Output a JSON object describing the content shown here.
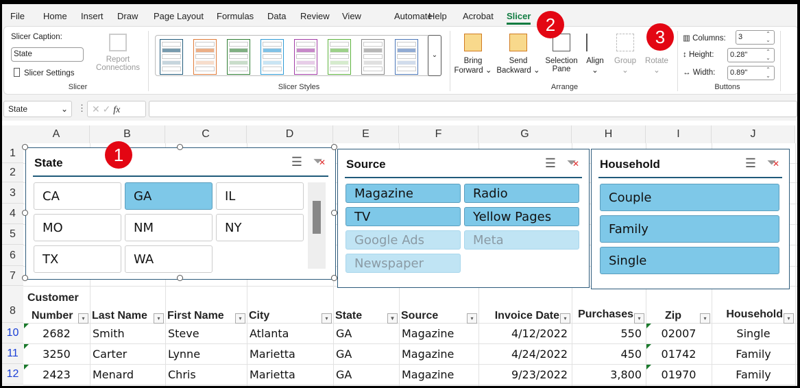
{
  "menu_tabs": [
    "File",
    "Home",
    "Insert",
    "Draw",
    "Page Layout",
    "Formulas",
    "Data",
    "Review",
    "View",
    "Automate",
    "Help",
    "Acrobat",
    "Slicer"
  ],
  "active_tab": "Slicer",
  "ribbon": {
    "slicer_group": {
      "caption_label": "Slicer Caption:",
      "caption_value": "State",
      "settings": "Slicer Settings",
      "report_connections": "Report Connections",
      "group_label": "Slicer"
    },
    "styles_group": {
      "group_label": "Slicer Styles",
      "colors": [
        "#1f5a7a",
        "#e07b39",
        "#2e7d32",
        "#2e9bd6",
        "#a23ca6",
        "#5db33d",
        "#888888",
        "#4a76b8"
      ]
    },
    "arrange_group": {
      "bring_forward": "Bring Forward",
      "send_backward": "Send Backward",
      "selection_pane": "Selection Pane",
      "align": "Align",
      "group": "Group",
      "rotate": "Rotate",
      "group_label": "Arrange"
    },
    "buttons_group": {
      "columns_label": "Columns:",
      "columns_value": "3",
      "height_label": "Height:",
      "height_value": "0.28\"",
      "width_label": "Width:",
      "width_value": "0.89\"",
      "group_label": "Buttons"
    }
  },
  "formula_bar": {
    "name_box": "State",
    "fx": "fx",
    "value": ""
  },
  "badges": [
    "1",
    "2",
    "3"
  ],
  "columns": [
    "A",
    "B",
    "C",
    "D",
    "E",
    "F",
    "G",
    "H",
    "I",
    "J"
  ],
  "rows": [
    "1",
    "2",
    "3",
    "4",
    "5",
    "6",
    "7",
    "8",
    "10",
    "11",
    "12"
  ],
  "slicers": {
    "state": {
      "title": "State",
      "items": [
        {
          "label": "CA",
          "state": "normal"
        },
        {
          "label": "GA",
          "state": "selected"
        },
        {
          "label": "IL",
          "state": "normal"
        },
        {
          "label": "MO",
          "state": "normal"
        },
        {
          "label": "NM",
          "state": "normal"
        },
        {
          "label": "NY",
          "state": "normal"
        },
        {
          "label": "TX",
          "state": "normal"
        },
        {
          "label": "WA",
          "state": "normal"
        }
      ]
    },
    "source": {
      "title": "Source",
      "items": [
        {
          "label": "Magazine",
          "state": "selected"
        },
        {
          "label": "Radio",
          "state": "selected"
        },
        {
          "label": "TV",
          "state": "selected"
        },
        {
          "label": "Yellow Pages",
          "state": "selected"
        },
        {
          "label": "Google Ads",
          "state": "nodata"
        },
        {
          "label": "Meta",
          "state": "nodata"
        },
        {
          "label": "Newspaper",
          "state": "nodata"
        }
      ]
    },
    "household": {
      "title": "Household",
      "items": [
        {
          "label": "Couple",
          "state": "selected"
        },
        {
          "label": "Family",
          "state": "selected"
        },
        {
          "label": "Single",
          "state": "selected"
        }
      ]
    }
  },
  "table": {
    "headers": [
      "Customer Number",
      "Last Name",
      "First Name",
      "City",
      "State",
      "Source",
      "Invoice Date",
      "Purchases",
      "Zip",
      "Household"
    ],
    "header_line1": "Customer",
    "header_line2": "Number",
    "rows": [
      [
        "2682",
        "Smith",
        "Steve",
        "Atlanta",
        "GA",
        "Magazine",
        "4/12/2022",
        "550",
        "02007",
        "Single"
      ],
      [
        "3250",
        "Carter",
        "Lynne",
        "Marietta",
        "GA",
        "Magazine",
        "4/24/2022",
        "450",
        "01742",
        "Family"
      ],
      [
        "2423",
        "Menard",
        "Chris",
        "Marietta",
        "GA",
        "Magazine",
        "9/23/2022",
        "3,800",
        "01970",
        "Family"
      ]
    ]
  }
}
